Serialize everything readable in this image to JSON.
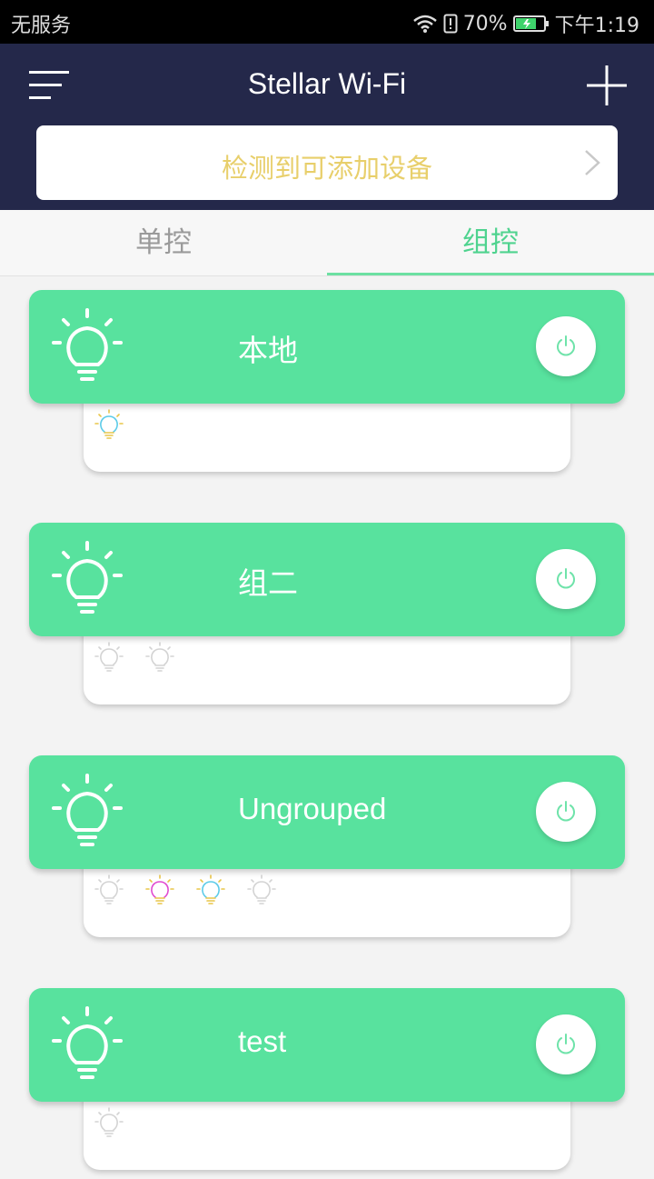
{
  "status_bar": {
    "carrier": "无服务",
    "battery": "70%",
    "time": "下午1:19"
  },
  "header": {
    "title": "Stellar Wi-Fi",
    "menu_icon": "hamburger-icon",
    "add_icon": "plus-icon",
    "detect_banner": "检测到可添加设备"
  },
  "tabs": [
    {
      "label": "单控",
      "active": false
    },
    {
      "label": "组控",
      "active": true
    }
  ],
  "colors": {
    "header_bg": "#24284a",
    "card_green": "#58e29e",
    "tab_active": "#4fd38f",
    "banner_text": "#e8cf6b"
  },
  "groups": [
    {
      "name": "本地",
      "devices": [
        "cyan-yellow"
      ]
    },
    {
      "name": "组二",
      "devices": [
        "gray",
        "gray"
      ]
    },
    {
      "name": "Ungrouped",
      "devices": [
        "gray",
        "magenta-yellow",
        "cyan-yellow",
        "gray"
      ]
    },
    {
      "name": "test",
      "devices": [
        "gray"
      ]
    }
  ]
}
